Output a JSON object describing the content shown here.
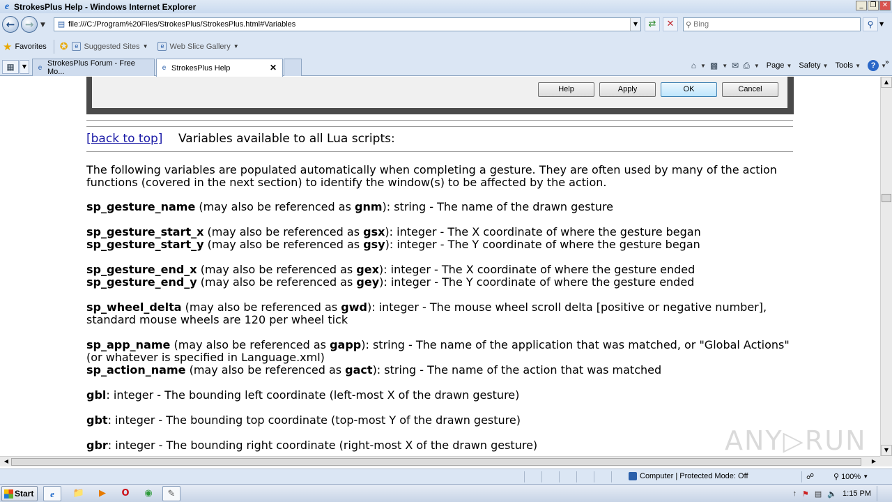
{
  "window": {
    "title": "StrokesPlus Help - Windows Internet Explorer",
    "min_label": "_",
    "max_label": "❐",
    "close_label": "✕"
  },
  "address_bar": {
    "url": "file:///C:/Program%20Files/StrokesPlus/StrokesPlus.html#Variables"
  },
  "search": {
    "placeholder": "Bing"
  },
  "favorites_bar": {
    "favorites_label": "Favorites",
    "items": [
      {
        "label": "Suggested Sites"
      },
      {
        "label": "Web Slice Gallery"
      }
    ]
  },
  "tabs": [
    {
      "label": "StrokesPlus Forum - Free Mo..."
    },
    {
      "label": "StrokesPlus Help",
      "active": true,
      "close_label": "✕"
    }
  ],
  "command_bar": {
    "page_label": "Page",
    "safety_label": "Safety",
    "tools_label": "Tools"
  },
  "dialog": {
    "buttons": {
      "help": "Help",
      "apply": "Apply",
      "ok": "OK",
      "cancel": "Cancel"
    }
  },
  "content": {
    "back_to_top": "[back to top]",
    "section_title": "Variables available to all Lua scripts:",
    "intro": "The following variables are populated automatically when completing a gesture. They are often used by many of the action functions (covered in the next section) to identify the window(s) to be affected by the action.",
    "variables": [
      {
        "name": "sp_gesture_name",
        "pre": " (may also be referenced as ",
        "alias": "gnm",
        "desc": "): string - The name of the drawn gesture"
      },
      {
        "name": "sp_gesture_start_x",
        "pre": " (may also be referenced as ",
        "alias": "gsx",
        "desc": "): integer - The X coordinate of where the gesture began"
      },
      {
        "name": "sp_gesture_start_y",
        "pre": " (may also be referenced as ",
        "alias": "gsy",
        "desc": "): integer - The Y coordinate of where the gesture began"
      },
      {
        "name": "sp_gesture_end_x",
        "pre": " (may also be referenced as ",
        "alias": "gex",
        "desc": "): integer - The X coordinate of where the gesture ended"
      },
      {
        "name": "sp_gesture_end_y",
        "pre": " (may also be referenced as ",
        "alias": "gey",
        "desc": "): integer - The Y coordinate of where the gesture ended"
      },
      {
        "name": "sp_wheel_delta",
        "pre": " (may also be referenced as ",
        "alias": "gwd",
        "desc": "): integer - The mouse wheel scroll delta [positive or negative number], standard mouse wheels are 120 per wheel tick"
      },
      {
        "name": "sp_app_name",
        "pre": " (may also be referenced as ",
        "alias": "gapp",
        "desc": "): string - The name of the application that was matched, or \"Global Actions\" (or whatever is specified in Language.xml)"
      },
      {
        "name": "sp_action_name",
        "pre": " (may also be referenced as ",
        "alias": "gact",
        "desc": "): string - The name of the action that was matched"
      },
      {
        "name": "gbl",
        "pre": "",
        "alias": "",
        "desc": ": integer - The bounding left coordinate (left-most X of the drawn gesture)"
      },
      {
        "name": "gbt",
        "pre": "",
        "alias": "",
        "desc": ": integer - The bounding top coordinate (top-most Y of the drawn gesture)"
      },
      {
        "name": "gbr",
        "pre": "",
        "alias": "",
        "desc": ": integer - The bounding right coordinate (right-most X of the drawn gesture)"
      }
    ]
  },
  "status_bar": {
    "zone": "Computer | Protected Mode: Off",
    "zoom": "100%"
  },
  "taskbar": {
    "start_label": "Start",
    "clock": "1:15 PM"
  },
  "watermark": "ANY▷RUN"
}
